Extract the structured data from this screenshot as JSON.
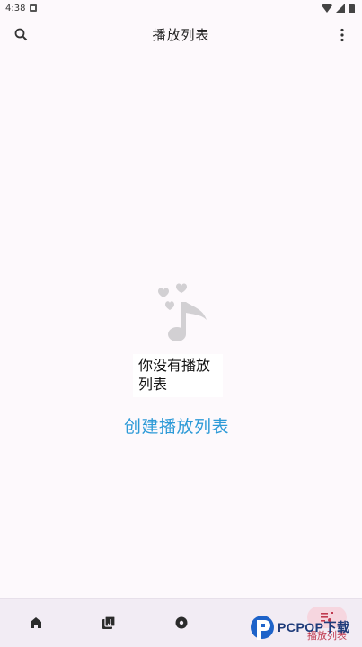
{
  "status_bar": {
    "time": "4:38"
  },
  "app_bar": {
    "title": "播放列表"
  },
  "empty_state": {
    "line1": "你没有播放",
    "line2": "列表",
    "create_link": "创建播放列表"
  },
  "bottom_nav": {
    "items": [
      {
        "icon": "home-icon"
      },
      {
        "icon": "library-icon"
      },
      {
        "icon": "record-icon"
      },
      {
        "icon": "playlist-icon",
        "label": "播放列表",
        "active": true
      }
    ]
  },
  "watermark": {
    "text": "PCPOP下载"
  },
  "colors": {
    "accent": "#2d9ad7",
    "active": "#c0394f",
    "active_pill": "#f6d6df"
  }
}
